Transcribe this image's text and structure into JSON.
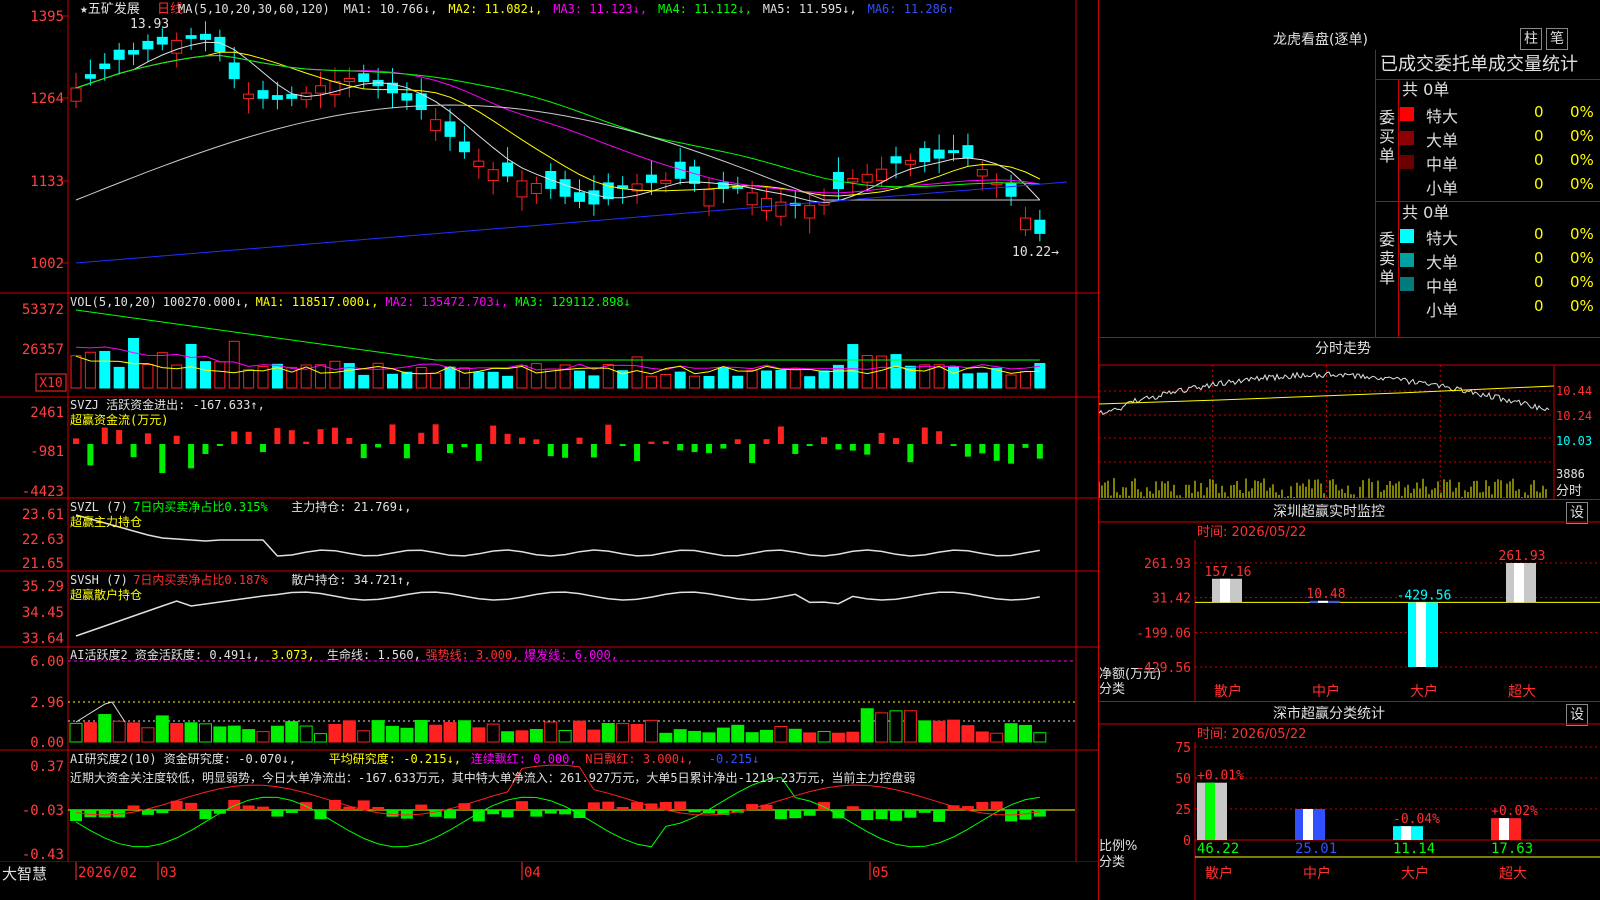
{
  "app": {
    "brand": "大智慧"
  },
  "main": {
    "stock_name": "★五矿发展",
    "period": "日线",
    "ma_line": [
      {
        "text": "MA(5,10,20,30,60,120)",
        "color": "#e0e0e0"
      },
      {
        "text": "MA1: 10.766↓,",
        "color": "#e0e0e0"
      },
      {
        "text": "MA2: 11.082↓,",
        "color": "#ffff00"
      },
      {
        "text": "MA3: 11.123↓,",
        "color": "#ff00ff"
      },
      {
        "text": "MA4: 11.112↓,",
        "color": "#00ff00"
      },
      {
        "text": "MA5: 11.595↓,",
        "color": "#e0e0e0"
      },
      {
        "text": "MA6: 11.286↑",
        "color": "#3050ff"
      }
    ],
    "price_ticks": [
      "1395",
      "1264",
      "1133",
      "1002"
    ],
    "high_label": "13.93",
    "low_label": "10.22→",
    "vol_line": [
      {
        "text": "VOL(5,10,20)",
        "color": "#e0e0e0"
      },
      {
        "text": "100270.000↓,",
        "color": "#e0e0e0"
      },
      {
        "text": "MA1: 118517.000↓,",
        "color": "#ffff00"
      },
      {
        "text": "MA2: 135472.703↓,",
        "color": "#ff00ff"
      },
      {
        "text": "MA3: 129112.898↓",
        "color": "#00ff00"
      }
    ],
    "vol_ticks": [
      "53372",
      "26357"
    ],
    "vol_unit": "X10",
    "svzj_line": "SVZJ  活跃资金进出: -167.633↑,",
    "svzj_sub": "超赢资金流(万元)",
    "svzj_ticks": [
      "2461",
      "-981",
      "-4423"
    ],
    "svzl_line": [
      {
        "text": "SVZL (7)",
        "color": "#e0e0e0"
      },
      {
        "text": "7日内买卖净占比0.315%",
        "color": "#00ff00"
      },
      {
        "text": "主力持仓: 21.769↓,",
        "color": "#e0e0e0"
      }
    ],
    "svzl_sub": "超赢主力持仓",
    "svzl_ticks": [
      "23.61",
      "22.63",
      "21.65"
    ],
    "svsh_line": [
      {
        "text": "SVSH (7)",
        "color": "#e0e0e0"
      },
      {
        "text": "7日内买卖净占比0.187%",
        "color": "#ff3030"
      },
      {
        "text": "散户持仓: 34.721↑,",
        "color": "#e0e0e0"
      }
    ],
    "svsh_sub": "超赢散户持仓",
    "svsh_ticks": [
      "35.29",
      "34.45",
      "33.64"
    ],
    "ai1_line": [
      {
        "text": "AI活跃度2 资金活跃度: 0.491↓,",
        "color": "#e0e0e0"
      },
      {
        "text": "3.073,",
        "color": "#ffff00"
      },
      {
        "text": "生命线: 1.560,",
        "color": "#e0e0e0"
      },
      {
        "text": "强势线: 3.000,",
        "color": "#ff3030"
      },
      {
        "text": "爆发线: 6.000,",
        "color": "#ff00ff"
      }
    ],
    "ai1_ticks": [
      "6.00",
      "2.96",
      "0.00"
    ],
    "ai2_line": [
      {
        "text": "AI研究度2(10) 资金研究度: -0.070↓,",
        "color": "#e0e0e0"
      },
      {
        "text": "平均研究度: -0.215↓,",
        "color": "#ffff00"
      },
      {
        "text": "连续飘红: 0.000,",
        "color": "#ff00ff"
      },
      {
        "text": "N日飘红: 3.000↓,",
        "color": "#ff3030"
      },
      {
        "text": "-0.215↓",
        "color": "#3050ff"
      }
    ],
    "ai2_note": "近期大资金关注度较低，明显弱势，今日大单净流出：-167.633万元，其中特大单净流入：261.927万元，大单5日累计净出-1219.23万元，当前主力控盘弱",
    "ai2_ticks": [
      "0.37",
      "-0.03",
      "-0.43"
    ],
    "date_labels": [
      "2026/02",
      "03",
      "04",
      "05"
    ]
  },
  "side": {
    "title": "龙虎看盘(逐单)",
    "btn_bar": "柱",
    "btn_pen": "笔",
    "header": "已成交委托单成交量统计",
    "buy_label": "委买单",
    "sell_label": "委卖单",
    "buy_total": "共 0单",
    "sell_total": "共 0单",
    "buy_rows": [
      {
        "name": "特大",
        "num": "0",
        "pct": "0%",
        "color": "#ff0000"
      },
      {
        "name": "大单",
        "num": "0",
        "pct": "0%",
        "color": "#8b0000"
      },
      {
        "name": "中单",
        "num": "0",
        "pct": "0%",
        "color": "#6b0000"
      },
      {
        "name": "小单",
        "num": "0",
        "pct": "0%",
        "color": "#000000"
      }
    ],
    "sell_rows": [
      {
        "name": "特大",
        "num": "0",
        "pct": "0%",
        "color": "#00ffff"
      },
      {
        "name": "大单",
        "num": "0",
        "pct": "0%",
        "color": "#00a0a0"
      },
      {
        "name": "中单",
        "num": "0",
        "pct": "0%",
        "color": "#007a7a"
      },
      {
        "name": "小单",
        "num": "0",
        "pct": "0%",
        "color": "#000000"
      }
    ],
    "intraday_title": "分时走势",
    "intraday_ticks": [
      "10.44",
      "10.24",
      "10.03"
    ],
    "intraday_vol": "3886",
    "intraday_unit": "分时",
    "monitor_title": "深圳超赢实时监控",
    "monitor_btn": "设",
    "monitor_time": "时间: 2026/05/22",
    "monitor_ticks": [
      "261.93",
      "31.42",
      "-199.06",
      "-429.56"
    ],
    "monitor_axis_title": "净额(万元)",
    "monitor_axis_sub": "分类",
    "monitor_chart": {
      "categories": [
        "散户",
        "中户",
        "大户",
        "超大"
      ],
      "values": [
        157.16,
        10.48,
        -429.56,
        261.93
      ],
      "labels": [
        "157.16",
        "10.48",
        "-429.56",
        "261.93"
      ],
      "ylim": [
        -429.56,
        261.93
      ]
    },
    "class_title": "深市超赢分类统计",
    "class_btn": "设",
    "class_time": "时间: 2026/05/22",
    "class_ticks": [
      "75",
      "50",
      "25",
      "0"
    ],
    "class_axis_title": "比例%",
    "class_axis_sub": "分类",
    "class_chart": {
      "categories": [
        "散户",
        "中户",
        "大户",
        "超大"
      ],
      "values": [
        46.22,
        25.01,
        11.14,
        17.63
      ],
      "labels": [
        "46.22",
        "25.01",
        "11.14",
        "17.63"
      ],
      "changes": [
        "+0.01%",
        "",
        "-0.04%",
        "+0.02%"
      ],
      "ylim": [
        0,
        75
      ]
    }
  }
}
